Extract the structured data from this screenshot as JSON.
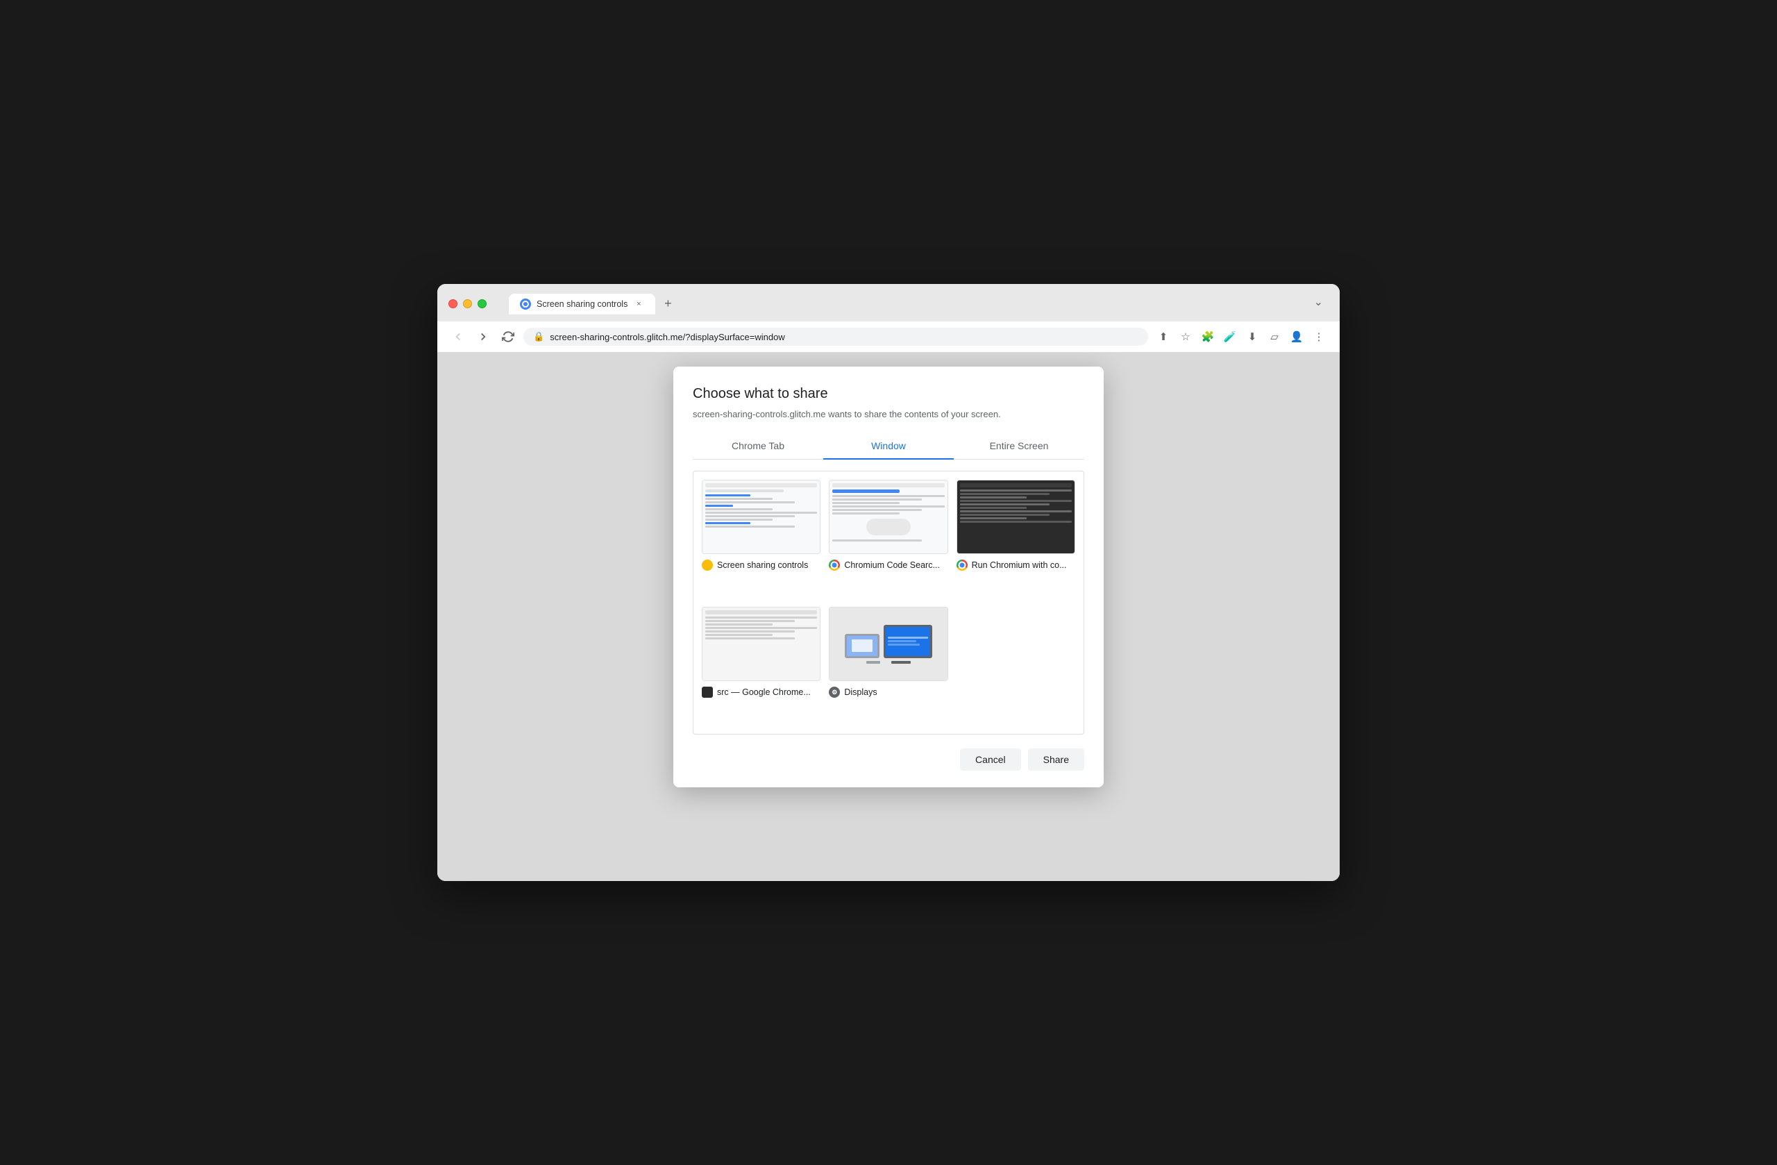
{
  "browser": {
    "tab_title": "Screen sharing controls",
    "tab_close_label": "×",
    "new_tab_label": "+",
    "tab_overflow_label": "⌄",
    "address": "screen-sharing-controls.glitch.me/?displaySurface=window",
    "back_tooltip": "Back",
    "forward_tooltip": "Forward",
    "reload_tooltip": "Reload"
  },
  "dialog": {
    "title": "Choose what to share",
    "subtitle": "screen-sharing-controls.glitch.me wants to share the contents of your screen.",
    "tabs": [
      {
        "id": "chrome-tab",
        "label": "Chrome Tab",
        "active": false
      },
      {
        "id": "window",
        "label": "Window",
        "active": true
      },
      {
        "id": "entire-screen",
        "label": "Entire Screen",
        "active": false
      }
    ],
    "windows": [
      {
        "id": "screen-sharing-controls",
        "label": "Screen sharing controls",
        "favicon_type": "yellow",
        "type": "browser"
      },
      {
        "id": "chromium-code-search",
        "label": "Chromium Code Searc...",
        "favicon_type": "chrome",
        "type": "browser"
      },
      {
        "id": "run-chromium",
        "label": "Run Chromium with co...",
        "favicon_type": "chrome",
        "type": "browser"
      },
      {
        "id": "src-google-chrome",
        "label": "src — Google Chrome...",
        "favicon_type": "dark",
        "type": "terminal"
      },
      {
        "id": "displays",
        "label": "Displays",
        "favicon_type": "gear",
        "type": "display"
      }
    ],
    "cancel_label": "Cancel",
    "share_label": "Share"
  }
}
